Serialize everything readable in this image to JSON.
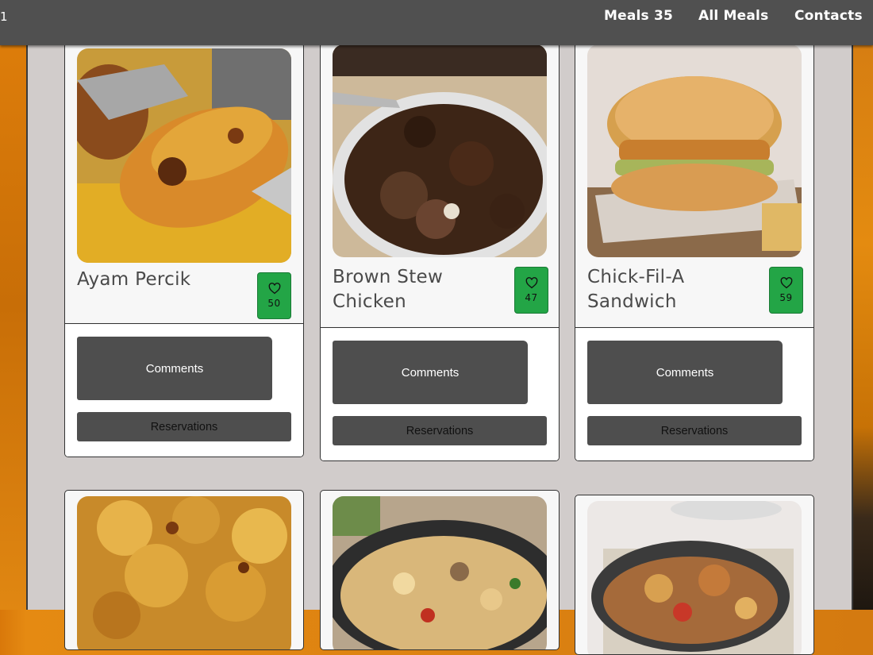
{
  "nav": {
    "brand_fragment": "1",
    "links": [
      {
        "label": "Meals 35"
      },
      {
        "label": "All Meals"
      },
      {
        "label": "Contacts"
      }
    ]
  },
  "meals": [
    {
      "title_line1": "Ayam Percik",
      "title_line2": "",
      "likes": "50",
      "image": "grilled chicken on fork"
    },
    {
      "title_line1": "Brown Stew",
      "title_line2": "Chicken",
      "likes": "47",
      "image": "brown stew chicken in bowl"
    },
    {
      "title_line1": "Chick-Fil-A",
      "title_line2": "Sandwich",
      "likes": "59",
      "image": "chicken sandwich with fries"
    },
    {
      "title_line1": "",
      "title_line2": "",
      "likes": "",
      "image": "potato gratin"
    },
    {
      "title_line1": "",
      "title_line2": "",
      "likes": "",
      "image": "farfalle pasta in pan"
    },
    {
      "title_line1": "",
      "title_line2": "",
      "likes": "",
      "image": "chicken casserole in dutch oven"
    }
  ],
  "buttons": {
    "comments": "Comments",
    "reservations": "Reservations"
  },
  "colors": {
    "topbar": "#505050",
    "board": "#d1cccb",
    "like_green": "#23a546",
    "button": "#4e4e4e",
    "page_orange": "#e08712"
  },
  "icons": {
    "like": "heart-icon"
  }
}
